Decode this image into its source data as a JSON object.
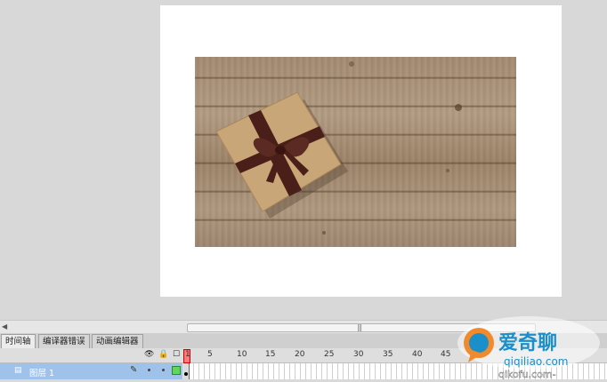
{
  "panel": {
    "tabs": [
      {
        "label": "时间轴",
        "active": true
      },
      {
        "label": "编译器错误",
        "active": false
      },
      {
        "label": "动画编辑器",
        "active": false
      }
    ]
  },
  "timeline": {
    "ruler_labels": [
      "1",
      "5",
      "10",
      "15",
      "20",
      "25",
      "30",
      "35",
      "40",
      "45"
    ],
    "layer": {
      "name": "图层 1"
    }
  },
  "watermark": {
    "brand": "爱奇聊",
    "domain": "qiqiliao.com",
    "tagline": "qikofu.com-"
  },
  "colors": {
    "stage": "#ffffff",
    "workspace": "#d8d8d8",
    "layer_selected": "#9fc2ea",
    "playhead": "#ff7b7b",
    "ribbon": "#4a1f1a",
    "box": "#c9a678"
  }
}
